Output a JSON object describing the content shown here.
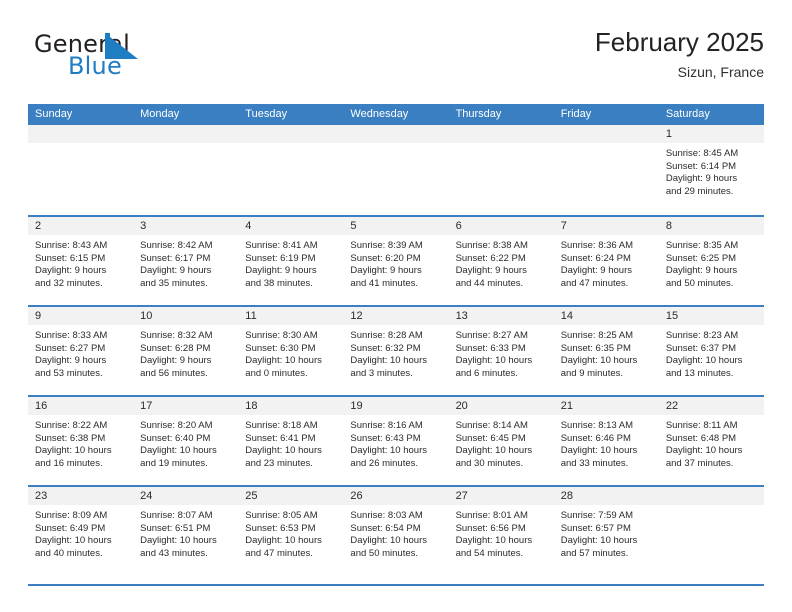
{
  "brand": {
    "name_part1": "General",
    "name_part2": "Blue",
    "flag_icon": "blue-triangle-flag-icon",
    "accent_color": "#1f7dc4"
  },
  "header": {
    "title": "February 2025",
    "subtitle": "Sizun, France"
  },
  "theme": {
    "header_blue": "#3a7fc1",
    "daynum_band": "#f2f2f2",
    "text": "#2b2b2b"
  },
  "calendar": {
    "weekdays": [
      "Sunday",
      "Monday",
      "Tuesday",
      "Wednesday",
      "Thursday",
      "Friday",
      "Saturday"
    ],
    "weeks": [
      [
        {
          "day": "",
          "empty": true
        },
        {
          "day": "",
          "empty": true
        },
        {
          "day": "",
          "empty": true
        },
        {
          "day": "",
          "empty": true
        },
        {
          "day": "",
          "empty": true
        },
        {
          "day": "",
          "empty": true
        },
        {
          "day": "1",
          "sunrise": "Sunrise: 8:45 AM",
          "sunset": "Sunset: 6:14 PM",
          "daylight1": "Daylight: 9 hours",
          "daylight2": "and 29 minutes."
        }
      ],
      [
        {
          "day": "2",
          "sunrise": "Sunrise: 8:43 AM",
          "sunset": "Sunset: 6:15 PM",
          "daylight1": "Daylight: 9 hours",
          "daylight2": "and 32 minutes."
        },
        {
          "day": "3",
          "sunrise": "Sunrise: 8:42 AM",
          "sunset": "Sunset: 6:17 PM",
          "daylight1": "Daylight: 9 hours",
          "daylight2": "and 35 minutes."
        },
        {
          "day": "4",
          "sunrise": "Sunrise: 8:41 AM",
          "sunset": "Sunset: 6:19 PM",
          "daylight1": "Daylight: 9 hours",
          "daylight2": "and 38 minutes."
        },
        {
          "day": "5",
          "sunrise": "Sunrise: 8:39 AM",
          "sunset": "Sunset: 6:20 PM",
          "daylight1": "Daylight: 9 hours",
          "daylight2": "and 41 minutes."
        },
        {
          "day": "6",
          "sunrise": "Sunrise: 8:38 AM",
          "sunset": "Sunset: 6:22 PM",
          "daylight1": "Daylight: 9 hours",
          "daylight2": "and 44 minutes."
        },
        {
          "day": "7",
          "sunrise": "Sunrise: 8:36 AM",
          "sunset": "Sunset: 6:24 PM",
          "daylight1": "Daylight: 9 hours",
          "daylight2": "and 47 minutes."
        },
        {
          "day": "8",
          "sunrise": "Sunrise: 8:35 AM",
          "sunset": "Sunset: 6:25 PM",
          "daylight1": "Daylight: 9 hours",
          "daylight2": "and 50 minutes."
        }
      ],
      [
        {
          "day": "9",
          "sunrise": "Sunrise: 8:33 AM",
          "sunset": "Sunset: 6:27 PM",
          "daylight1": "Daylight: 9 hours",
          "daylight2": "and 53 minutes."
        },
        {
          "day": "10",
          "sunrise": "Sunrise: 8:32 AM",
          "sunset": "Sunset: 6:28 PM",
          "daylight1": "Daylight: 9 hours",
          "daylight2": "and 56 minutes."
        },
        {
          "day": "11",
          "sunrise": "Sunrise: 8:30 AM",
          "sunset": "Sunset: 6:30 PM",
          "daylight1": "Daylight: 10 hours",
          "daylight2": "and 0 minutes."
        },
        {
          "day": "12",
          "sunrise": "Sunrise: 8:28 AM",
          "sunset": "Sunset: 6:32 PM",
          "daylight1": "Daylight: 10 hours",
          "daylight2": "and 3 minutes."
        },
        {
          "day": "13",
          "sunrise": "Sunrise: 8:27 AM",
          "sunset": "Sunset: 6:33 PM",
          "daylight1": "Daylight: 10 hours",
          "daylight2": "and 6 minutes."
        },
        {
          "day": "14",
          "sunrise": "Sunrise: 8:25 AM",
          "sunset": "Sunset: 6:35 PM",
          "daylight1": "Daylight: 10 hours",
          "daylight2": "and 9 minutes."
        },
        {
          "day": "15",
          "sunrise": "Sunrise: 8:23 AM",
          "sunset": "Sunset: 6:37 PM",
          "daylight1": "Daylight: 10 hours",
          "daylight2": "and 13 minutes."
        }
      ],
      [
        {
          "day": "16",
          "sunrise": "Sunrise: 8:22 AM",
          "sunset": "Sunset: 6:38 PM",
          "daylight1": "Daylight: 10 hours",
          "daylight2": "and 16 minutes."
        },
        {
          "day": "17",
          "sunrise": "Sunrise: 8:20 AM",
          "sunset": "Sunset: 6:40 PM",
          "daylight1": "Daylight: 10 hours",
          "daylight2": "and 19 minutes."
        },
        {
          "day": "18",
          "sunrise": "Sunrise: 8:18 AM",
          "sunset": "Sunset: 6:41 PM",
          "daylight1": "Daylight: 10 hours",
          "daylight2": "and 23 minutes."
        },
        {
          "day": "19",
          "sunrise": "Sunrise: 8:16 AM",
          "sunset": "Sunset: 6:43 PM",
          "daylight1": "Daylight: 10 hours",
          "daylight2": "and 26 minutes."
        },
        {
          "day": "20",
          "sunrise": "Sunrise: 8:14 AM",
          "sunset": "Sunset: 6:45 PM",
          "daylight1": "Daylight: 10 hours",
          "daylight2": "and 30 minutes."
        },
        {
          "day": "21",
          "sunrise": "Sunrise: 8:13 AM",
          "sunset": "Sunset: 6:46 PM",
          "daylight1": "Daylight: 10 hours",
          "daylight2": "and 33 minutes."
        },
        {
          "day": "22",
          "sunrise": "Sunrise: 8:11 AM",
          "sunset": "Sunset: 6:48 PM",
          "daylight1": "Daylight: 10 hours",
          "daylight2": "and 37 minutes."
        }
      ],
      [
        {
          "day": "23",
          "sunrise": "Sunrise: 8:09 AM",
          "sunset": "Sunset: 6:49 PM",
          "daylight1": "Daylight: 10 hours",
          "daylight2": "and 40 minutes."
        },
        {
          "day": "24",
          "sunrise": "Sunrise: 8:07 AM",
          "sunset": "Sunset: 6:51 PM",
          "daylight1": "Daylight: 10 hours",
          "daylight2": "and 43 minutes."
        },
        {
          "day": "25",
          "sunrise": "Sunrise: 8:05 AM",
          "sunset": "Sunset: 6:53 PM",
          "daylight1": "Daylight: 10 hours",
          "daylight2": "and 47 minutes."
        },
        {
          "day": "26",
          "sunrise": "Sunrise: 8:03 AM",
          "sunset": "Sunset: 6:54 PM",
          "daylight1": "Daylight: 10 hours",
          "daylight2": "and 50 minutes."
        },
        {
          "day": "27",
          "sunrise": "Sunrise: 8:01 AM",
          "sunset": "Sunset: 6:56 PM",
          "daylight1": "Daylight: 10 hours",
          "daylight2": "and 54 minutes."
        },
        {
          "day": "28",
          "sunrise": "Sunrise: 7:59 AM",
          "sunset": "Sunset: 6:57 PM",
          "daylight1": "Daylight: 10 hours",
          "daylight2": "and 57 minutes."
        },
        {
          "day": "",
          "empty": true
        }
      ]
    ]
  }
}
